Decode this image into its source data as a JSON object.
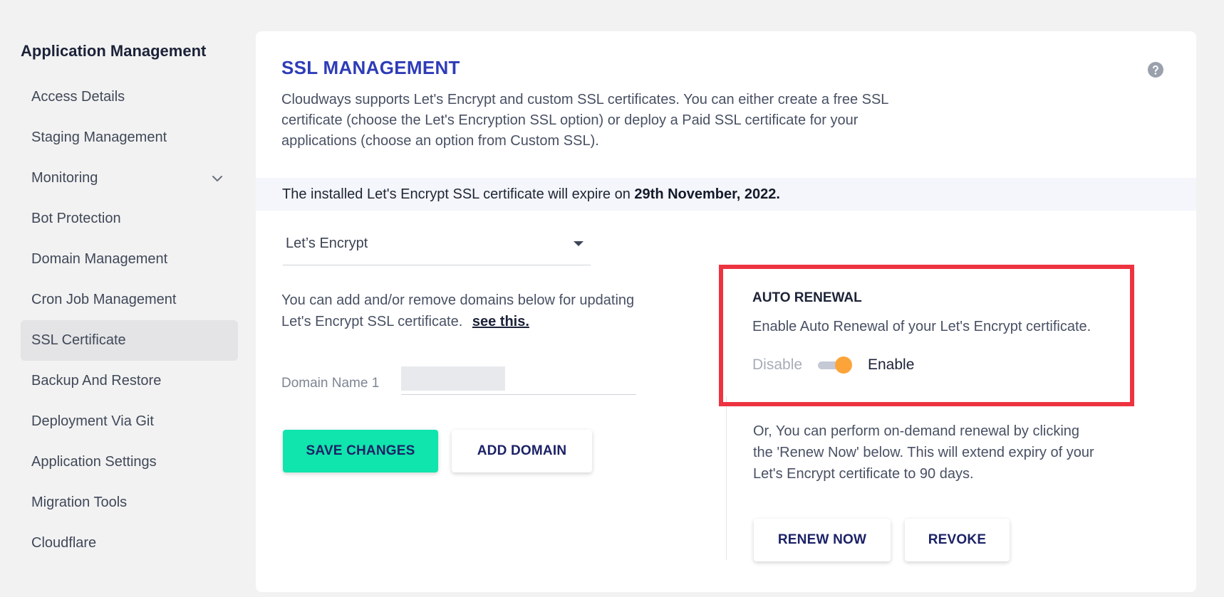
{
  "sidebar": {
    "title": "Application Management",
    "items": [
      {
        "label": "Access Details"
      },
      {
        "label": "Staging Management"
      },
      {
        "label": "Monitoring"
      },
      {
        "label": "Bot Protection"
      },
      {
        "label": "Domain Management"
      },
      {
        "label": "Cron Job Management"
      },
      {
        "label": "SSL Certificate",
        "active": true
      },
      {
        "label": "Backup And Restore"
      },
      {
        "label": "Deployment Via Git"
      },
      {
        "label": "Application Settings"
      },
      {
        "label": "Migration Tools"
      },
      {
        "label": "Cloudflare"
      }
    ]
  },
  "main": {
    "title": "SSL MANAGEMENT",
    "help_icon": "question-circle-icon",
    "description": "Cloudways supports Let's Encrypt and custom SSL certificates. You can either create a free SSL certificate (choose the Let's Encryption SSL option) or deploy a Paid SSL certificate for your applications (choose an option from Custom SSL).",
    "expiry": {
      "prefix": "The installed Let's Encrypt SSL certificate will expire on ",
      "date": "29th November, 2022."
    },
    "ssl_select": {
      "value": "Let’s Encrypt"
    },
    "domains_note": "You can add and/or remove domains below for updating Let's Encrypt SSL certificate.",
    "see_this_link": "see this.",
    "domain_field": {
      "label": "Domain Name 1",
      "value": ""
    },
    "save_button": "SAVE CHANGES",
    "add_domain_button": "ADD DOMAIN",
    "auto_renewal": {
      "title": "AUTO RENEWAL",
      "description": "Enable Auto Renewal of your Let's Encrypt certificate.",
      "disable_label": "Disable",
      "enable_label": "Enable",
      "enabled": true
    },
    "renew_note": "Or, You can perform on-demand renewal by clicking the 'Renew Now' below. This will extend expiry of your Let's Encrypt certificate to 90 days.",
    "renew_button": "RENEW NOW",
    "revoke_button": "REVOKE"
  },
  "colors": {
    "title_blue": "#2e3cb8",
    "save_green": "#0fe5ad",
    "highlight_red": "#ee3340",
    "toggle_orange": "#fca43a"
  }
}
